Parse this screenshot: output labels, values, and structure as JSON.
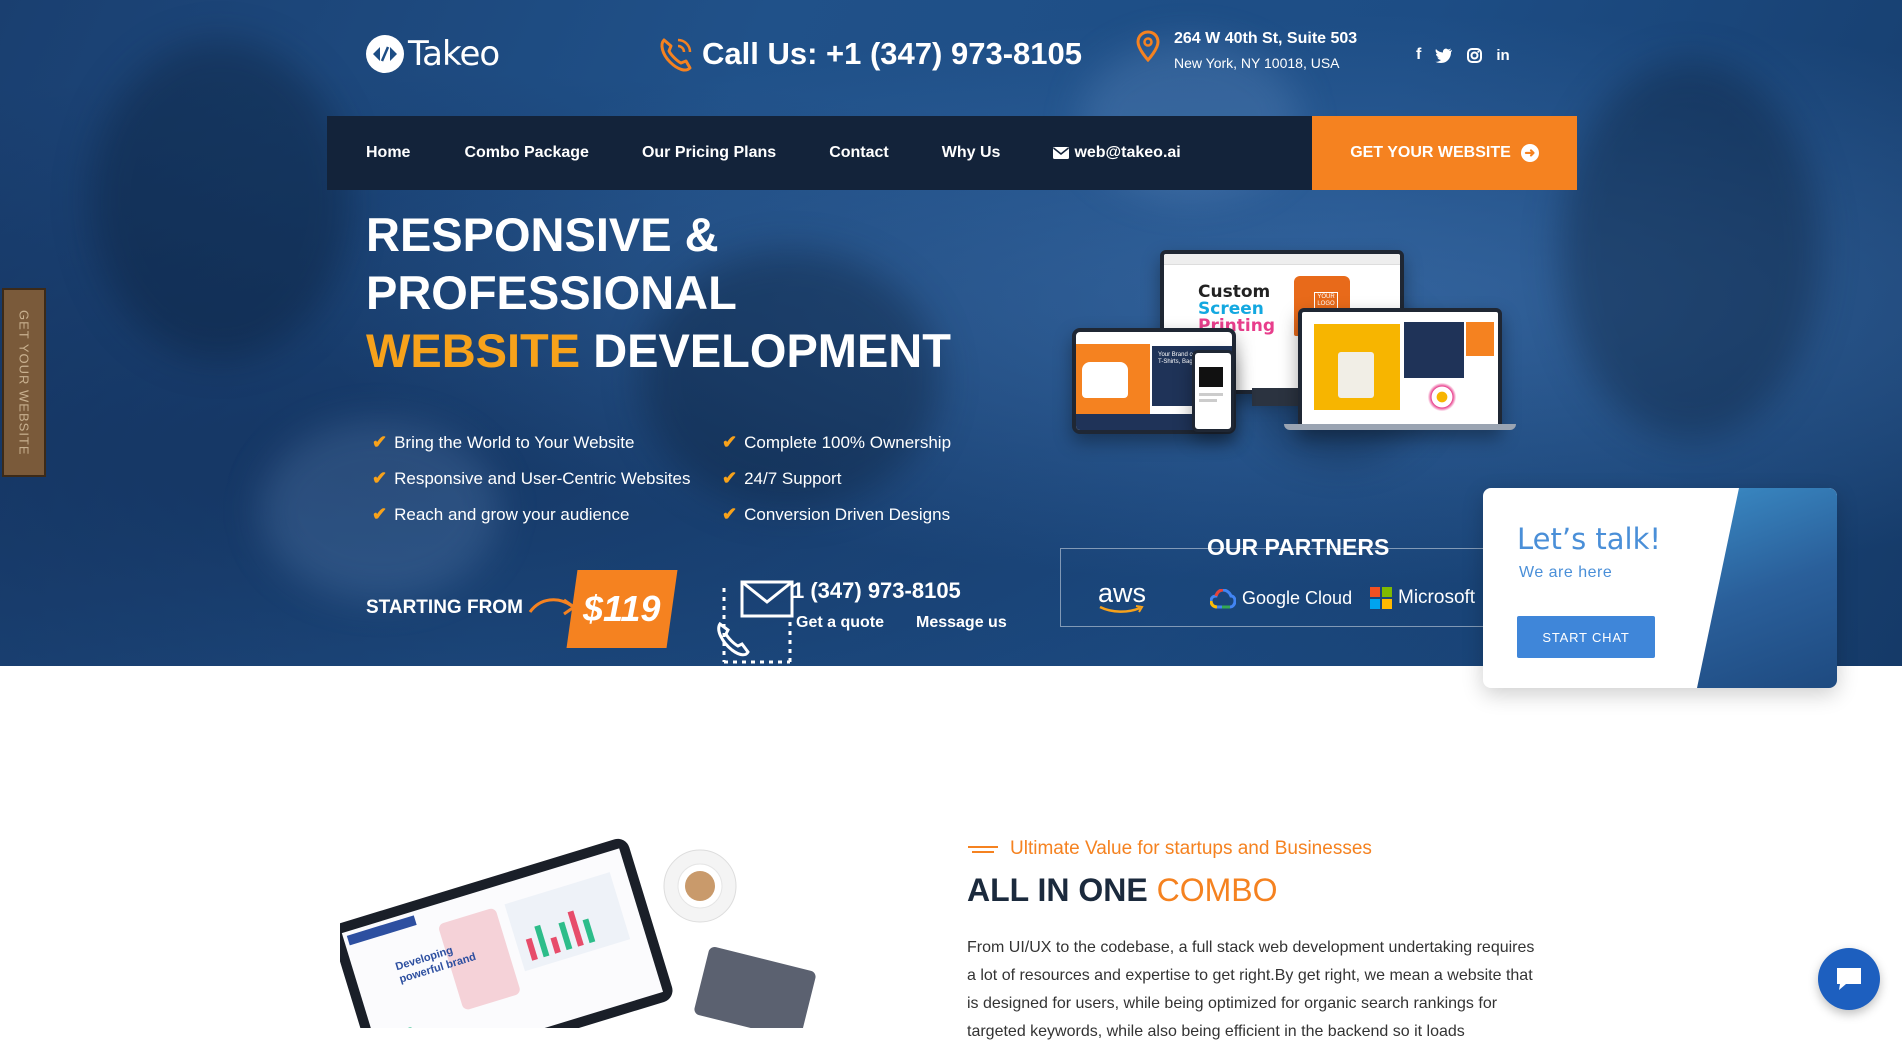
{
  "header": {
    "logo_text": "Takeo",
    "call_label": "Call Us: +1 (347) 973-8105",
    "address_line1": "264 W 40th St, Suite 503",
    "address_line2": "New York, NY 10018, USA",
    "social": [
      "facebook-icon",
      "twitter-icon",
      "instagram-icon",
      "linkedin-icon"
    ]
  },
  "nav": {
    "items": [
      "Home",
      "Combo Package",
      "Our Pricing Plans",
      "Contact",
      "Why Us"
    ],
    "email": "web@takeo.ai",
    "cta_label": "GET YOUR WEBSITE"
  },
  "sidetab": {
    "label": "GET YOUR WEBSITE"
  },
  "hero": {
    "headline_line1": "RESPONSIVE &",
    "headline_line2": "PROFESSIONAL",
    "headline_highlight": "WEBSITE",
    "headline_rest": "DEVELOPMENT",
    "features_left": [
      "Bring the World to Your Website",
      "Responsive and User-Centric Websites",
      "Reach and grow your audience"
    ],
    "features_right": [
      "Complete 100% Ownership",
      "24/7 Support",
      "Conversion Driven Designs"
    ],
    "starting_label": "STARTING FROM",
    "price": "$119",
    "phone": "1 (347) 973-8105",
    "quote_label": "Get a quote",
    "message_label": "Message us"
  },
  "mockup": {
    "title1": "Custom",
    "title2": "Screen",
    "title3": "Printing",
    "logo_badge": "YOUR LOGO",
    "tag": "Your Brand or Design T-Shirts, Bags & More"
  },
  "partners": {
    "title": "OUR PARTNERS",
    "aws": "aws",
    "google": "Google Cloud",
    "microsoft": "Microsoft"
  },
  "chat_card": {
    "title": "Let’s talk!",
    "subtitle": "We are here",
    "button": "START CHAT"
  },
  "combo": {
    "eyebrow": "Ultimate Value for startups and Businesses",
    "title_main": "ALL IN ONE",
    "title_highlight": "COMBO",
    "line1": "From UI/UX to the codebase, a full stack web development undertaking requires",
    "line2": "a lot of resources and expertise to get right.By get right, we mean a website that",
    "line3": "is designed for users, while being optimized for organic search rankings for",
    "line4": "targeted keywords, while also being efficient in the backend so it loads",
    "laptop_headline": "Developing powerful brand"
  },
  "colors": {
    "accent": "#f58220",
    "headline_accent": "#f7a21b",
    "nav_bg": "#13233a",
    "chat_blue": "#3f86d9"
  }
}
